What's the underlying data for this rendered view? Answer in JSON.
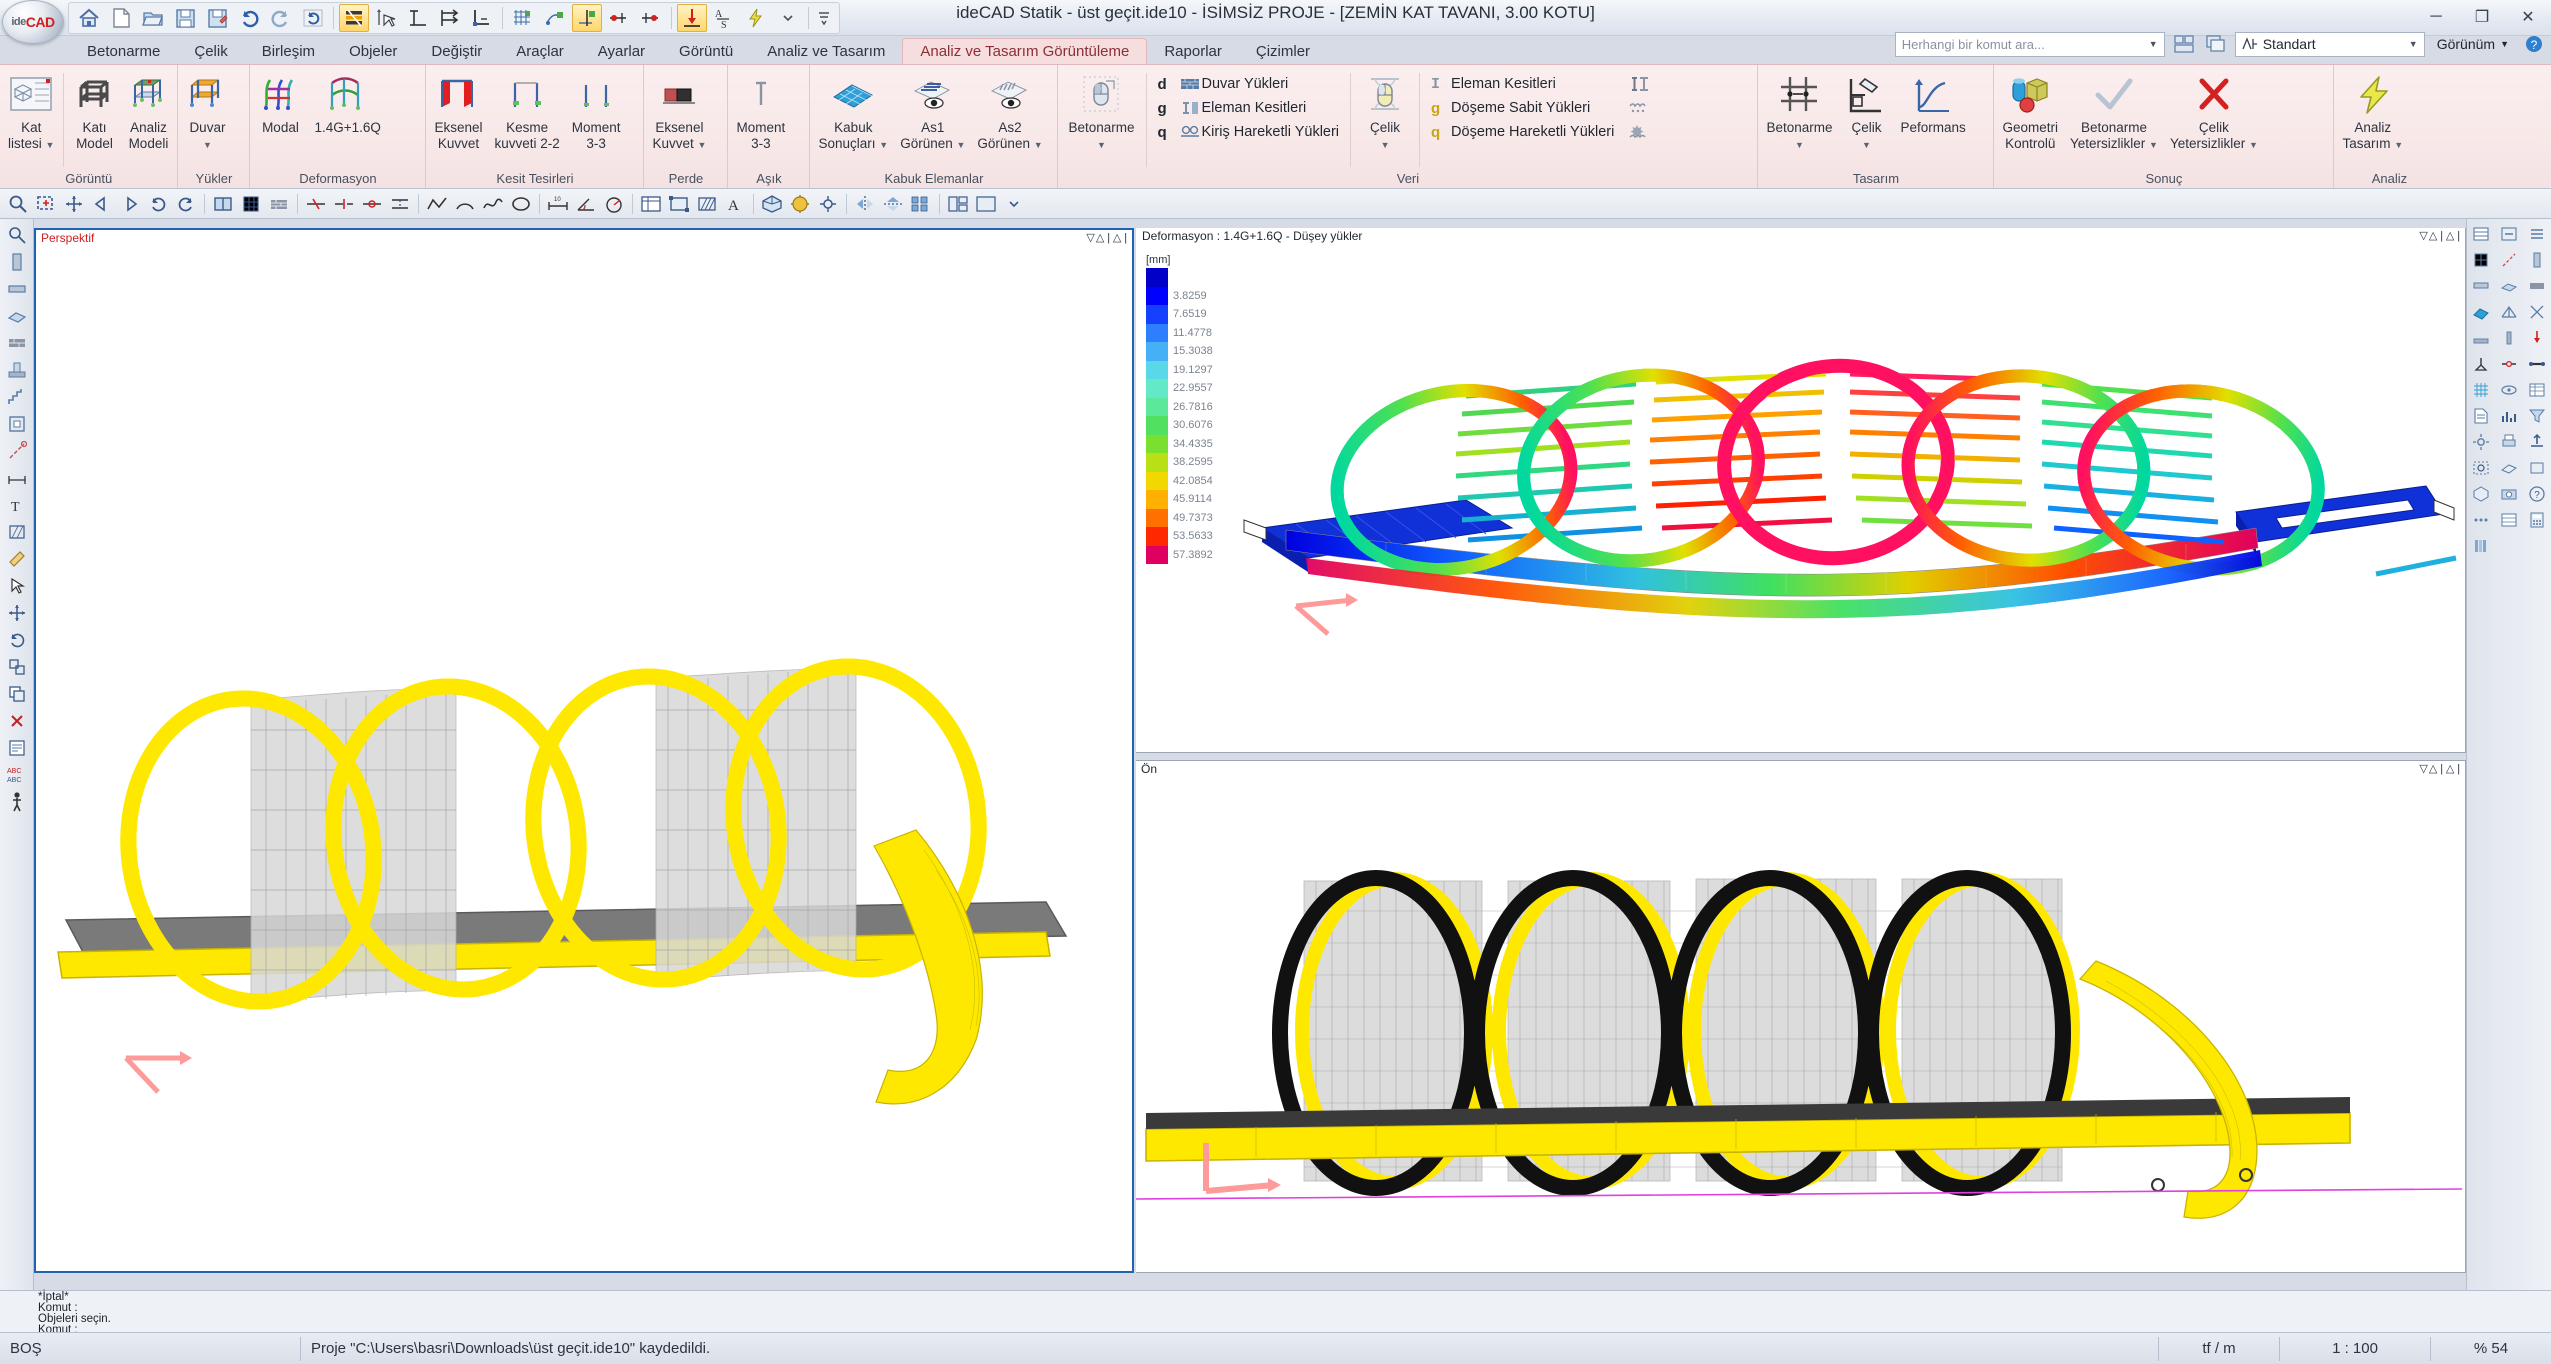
{
  "window": {
    "title": "ideCAD Statik - üst geçit.ide10 - İSİMSİZ PROJE - [ZEMİN KAT TAVANI,  3.00 KOTU]",
    "minimize": "─",
    "maximize": "❐",
    "close": "✕"
  },
  "logo": {
    "part1": "ide",
    "part2": "CAD"
  },
  "quick_access": {
    "items": [
      {
        "name": "home-icon",
        "label": "Ana Sayfa"
      },
      {
        "name": "new-file-icon",
        "label": "Yeni"
      },
      {
        "name": "open-folder-icon",
        "label": "Aç"
      },
      {
        "name": "save-icon",
        "label": "Kaydet"
      },
      {
        "name": "save-as-icon",
        "label": "Farklı Kaydet"
      },
      {
        "name": "undo-icon",
        "label": "Geri Al"
      },
      {
        "name": "redo-icon",
        "label": "İleri Al"
      },
      {
        "name": "refresh-icon",
        "label": "Yenile"
      },
      {
        "name": "layers-icon",
        "label": "Katmanlar"
      },
      {
        "name": "pointer-snap-icon",
        "label": "Yakalama"
      },
      {
        "name": "ortho-icon",
        "label": "Ortho"
      },
      {
        "name": "align-icon",
        "label": "Hizalama"
      },
      {
        "name": "corner-snap-icon",
        "label": "Köşe"
      },
      {
        "name": "grid-snap-icon",
        "label": "Grid Yakalama"
      },
      {
        "name": "node-snap-icon",
        "label": "Düğüm Yakalama"
      },
      {
        "name": "insert-node-icon",
        "label": "Düğüm Ekle"
      },
      {
        "name": "pin-support-icon",
        "label": "Mesnet"
      },
      {
        "name": "fix-support-icon",
        "label": "Ankastre"
      },
      {
        "name": "load-down-icon",
        "label": "Yük"
      },
      {
        "name": "axial-section-icon",
        "label": "A/S"
      },
      {
        "name": "lightning-icon",
        "label": "Analiz"
      }
    ],
    "more": "▼"
  },
  "tabs": [
    {
      "label": "Betonarme",
      "active": false
    },
    {
      "label": "Çelik",
      "active": false
    },
    {
      "label": "Birleşim",
      "active": false
    },
    {
      "label": "Objeler",
      "active": false
    },
    {
      "label": "Değiştir",
      "active": false
    },
    {
      "label": "Araçlar",
      "active": false
    },
    {
      "label": "Ayarlar",
      "active": false
    },
    {
      "label": "Görüntü",
      "active": false
    },
    {
      "label": "Analiz ve Tasarım",
      "active": false
    },
    {
      "label": "Analiz ve Tasarım Görüntüleme",
      "active": true
    },
    {
      "label": "Raporlar",
      "active": false
    },
    {
      "label": "Çizimler",
      "active": false
    }
  ],
  "search": {
    "placeholder": "Herhangi bir komut ara...",
    "dropdown": "▼"
  },
  "style_selector": {
    "value": "Standart",
    "dropdown": "▼",
    "prefix_icon": "style-icon"
  },
  "view_menu": {
    "label": "Görünüm",
    "dropdown": "▼"
  },
  "ribbon": {
    "groups": [
      {
        "label": "Görüntü",
        "buttons": [
          {
            "name": "kat-listesi-button",
            "line1": "Kat",
            "line2": "listesi",
            "caret": true,
            "icon": "story-list-icon"
          },
          {
            "name": "kati-model-button",
            "line1": "Katı",
            "line2": "Model",
            "caret": false,
            "icon": "solid-model-icon"
          },
          {
            "name": "analiz-modeli-button",
            "line1": "Analiz",
            "line2": "Modeli",
            "caret": false,
            "icon": "analysis-model-icon"
          }
        ]
      },
      {
        "label": "Yükler",
        "buttons": [
          {
            "name": "duvar-button",
            "line1": "Duvar",
            "line2": "",
            "caret": true,
            "icon": "wall-load-icon"
          }
        ]
      },
      {
        "label": "Deformasyon",
        "buttons": [
          {
            "name": "modal-button",
            "line1": "Modal",
            "line2": "",
            "caret": false,
            "icon": "modal-deform-icon"
          },
          {
            "name": "load-combo-button",
            "line1": "1.4G+1.6Q",
            "line2": "",
            "caret": false,
            "icon": "combo-deform-icon"
          }
        ]
      },
      {
        "label": "Kesit Tesirleri",
        "buttons": [
          {
            "name": "eksenel-kuvvet-button",
            "line1": "Eksenel",
            "line2": "Kuvvet",
            "caret": false,
            "icon": "axial-force-icon"
          },
          {
            "name": "kesme-kuvveti-button",
            "line1": "Kesme",
            "line2": "kuvveti 2-2",
            "caret": false,
            "icon": "shear-force-icon"
          },
          {
            "name": "moment-33-button",
            "line1": "Moment",
            "line2": "3-3",
            "caret": false,
            "icon": "moment-icon"
          }
        ]
      },
      {
        "label": "Perde",
        "buttons": [
          {
            "name": "perde-eksenel-kuvvet-button",
            "line1": "Eksenel",
            "line2": "Kuvvet",
            "caret": true,
            "icon": "shearwall-axial-icon"
          }
        ]
      },
      {
        "label": "Aşık",
        "buttons": [
          {
            "name": "asik-moment-button",
            "line1": "Moment",
            "line2": "3-3",
            "caret": false,
            "icon": "purlin-moment-icon"
          }
        ]
      },
      {
        "label": "Kabuk Elemanlar",
        "buttons": [
          {
            "name": "kabuk-sonuclari-button",
            "line1": "Kabuk",
            "line2": "Sonuçları",
            "caret": true,
            "icon": "shell-results-icon"
          },
          {
            "name": "as1-gorunen-button",
            "line1": "As1",
            "line2": "Görünen",
            "caret": true,
            "icon": "as1-icon"
          },
          {
            "name": "as2-gorunen-button",
            "line1": "As2",
            "line2": "Görünen",
            "caret": true,
            "icon": "as2-icon"
          }
        ]
      },
      {
        "label": "Veri",
        "mouse_buttons": [
          {
            "name": "betonarme-data-button",
            "label": "Betonarme",
            "caret": true,
            "icon": "mouse-concrete-icon"
          },
          {
            "name": "celik-data-button",
            "label": "Çelik",
            "caret": true,
            "icon": "mouse-steel-icon"
          }
        ],
        "lists": [
          [
            {
              "key": "d",
              "icon": "wall-loads-icon",
              "label": "Duvar Yükleri"
            },
            {
              "key": "g",
              "icon": "element-sections-icon",
              "label": "Eleman Kesitleri"
            },
            {
              "key": "q",
              "icon": "beam-live-loads-icon",
              "label": "Kiriş Hareketli Yükleri"
            }
          ],
          [
            {
              "key": "I",
              "icon": "steel-sections-icon",
              "label": "Eleman Kesitleri"
            },
            {
              "key": "g",
              "icon": "slab-dead-loads-icon",
              "label": "Döşeme Sabit Yükleri"
            },
            {
              "key": "q",
              "icon": "slab-live-loads-icon",
              "label": "Döşeme Hareketli Yükleri"
            }
          ]
        ],
        "side_icons": [
          "steel-profile-icon",
          "dead-load-icon",
          "live-load-icon"
        ]
      },
      {
        "label": "Tasarım",
        "buttons": [
          {
            "name": "tasarim-betonarme-button",
            "line1": "Betonarme",
            "line2": "",
            "caret": true,
            "icon": "rebar-design-icon"
          },
          {
            "name": "tasarim-celik-button",
            "line1": "Çelik",
            "line2": "",
            "caret": true,
            "icon": "steel-design-icon"
          },
          {
            "name": "tasarim-peformans-button",
            "line1": "Peformans",
            "line2": "",
            "caret": false,
            "icon": "performance-icon"
          }
        ]
      },
      {
        "label": "Sonuç",
        "buttons": [
          {
            "name": "geometri-kontrolu-button",
            "line1": "Geometri",
            "line2": "Kontrolü",
            "caret": false,
            "icon": "geometry-check-icon"
          },
          {
            "name": "betonarme-yetersizlikler-button",
            "line1": "Betonarme",
            "line2": "Yetersizlikler",
            "caret": true,
            "icon": "check-mark-icon"
          },
          {
            "name": "celik-yetersizlikler-button",
            "line1": "Çelik",
            "line2": "Yetersizlikler",
            "caret": true,
            "icon": "cross-mark-icon"
          }
        ]
      },
      {
        "label": "Analiz",
        "buttons": [
          {
            "name": "analiz-tasarim-button",
            "line1": "Analiz",
            "line2": "Tasarım",
            "caret": true,
            "icon": "lightning-bolt-icon"
          }
        ]
      }
    ]
  },
  "viewports": {
    "perspective": {
      "title": "Perspektif",
      "title_color": "#cc2222",
      "controls": "▽△|△|"
    },
    "deformation": {
      "title": "",
      "header": "Deformasyon :  1.4G+1.6Q  -  Düşey yükler",
      "controls": "▽△|△|",
      "legend_unit": "[mm]",
      "legend": [
        {
          "color": "#0000c8",
          "value": ""
        },
        {
          "color": "#0000ff",
          "value": "3.8259"
        },
        {
          "color": "#1540ff",
          "value": "7.6519"
        },
        {
          "color": "#2d7fff",
          "value": "11.4778"
        },
        {
          "color": "#45b0f5",
          "value": "15.3038"
        },
        {
          "color": "#58d8e8",
          "value": "19.1297"
        },
        {
          "color": "#63e8c8",
          "value": "22.9557"
        },
        {
          "color": "#5ce89a",
          "value": "26.7816"
        },
        {
          "color": "#52e060",
          "value": "30.6076"
        },
        {
          "color": "#7ae030",
          "value": "34.4335"
        },
        {
          "color": "#b8e015",
          "value": "38.2595"
        },
        {
          "color": "#f0d800",
          "value": "42.0854"
        },
        {
          "color": "#ffb000",
          "value": "45.9114"
        },
        {
          "color": "#ff7000",
          "value": "49.7373"
        },
        {
          "color": "#ff2800",
          "value": "53.5633"
        },
        {
          "color": "#e00060",
          "value": "57.3892"
        }
      ]
    },
    "front": {
      "title": "Ön",
      "title_color": "#222a33",
      "controls": "▽△|△|"
    }
  },
  "command_log": [
    "*İptal*",
    "Komut :",
    "Objeleri seçin.",
    "Komut :"
  ],
  "status_bar": {
    "mode": "BOŞ",
    "message": "Proje \"C:\\Users\\basri\\Downloads\\üst geçit.ide10\" kaydedildi.",
    "units": "tf / m",
    "scale": "1 : 100",
    "zoom": "% 54"
  }
}
